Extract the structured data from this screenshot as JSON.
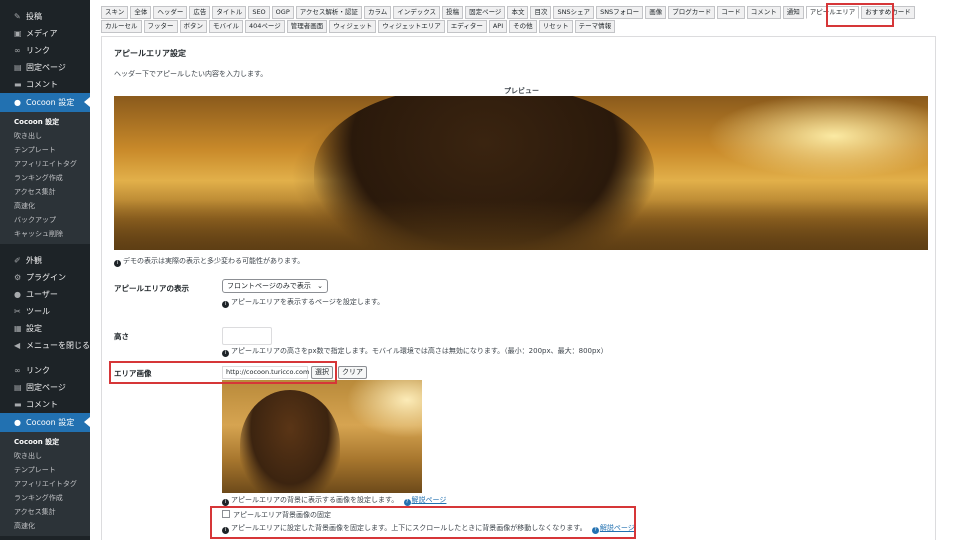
{
  "sidebar": {
    "top_items": [
      {
        "icon": "pin-icon",
        "glyph": "✎",
        "label": "投稿"
      },
      {
        "icon": "media-icon",
        "glyph": "▣",
        "label": "メディア"
      },
      {
        "icon": "link-icon",
        "glyph": "∞",
        "label": "リンク"
      },
      {
        "icon": "page-icon",
        "glyph": "▤",
        "label": "固定ページ"
      },
      {
        "icon": "comment-icon",
        "glyph": "▬",
        "label": "コメント"
      }
    ],
    "cocoon_label": "Cocoon 設定",
    "sub_items": [
      "Cocoon 設定",
      "吹き出し",
      "テンプレート",
      "アフィリエイトタグ",
      "ランキング作成",
      "アクセス集計",
      "高速化",
      "バックアップ",
      "キャッシュ削除"
    ],
    "bottom_items": [
      {
        "icon": "appearance-icon",
        "glyph": "✐",
        "label": "外観"
      },
      {
        "icon": "plugin-icon",
        "glyph": "⚙",
        "label": "プラグイン"
      },
      {
        "icon": "user-icon",
        "glyph": "●",
        "label": "ユーザー"
      },
      {
        "icon": "tool-icon",
        "glyph": "✂",
        "label": "ツール"
      },
      {
        "icon": "settings-icon",
        "glyph": "▦",
        "label": "設定"
      },
      {
        "icon": "collapse-icon",
        "glyph": "◀",
        "label": "メニューを閉じる"
      }
    ],
    "repeat_items": [
      {
        "icon": "link-icon",
        "glyph": "∞",
        "label": "リンク"
      },
      {
        "icon": "page-icon",
        "glyph": "▤",
        "label": "固定ページ"
      },
      {
        "icon": "comment-icon",
        "glyph": "▬",
        "label": "コメント"
      }
    ],
    "cocoon_label_2": "Cocoon 設定",
    "sub_items_2": [
      "Cocoon 設定",
      "吹き出し",
      "テンプレート",
      "アフィリエイトタグ",
      "ランキング作成",
      "アクセス集計",
      "高速化"
    ]
  },
  "tabs": {
    "row1": [
      "スキン",
      "全体",
      "ヘッダー",
      "広告",
      "タイトル",
      "SEO",
      "OGP",
      "アクセス解析・認証",
      "カラム",
      "インデックス",
      "投稿",
      "固定ページ",
      "本文",
      "目次",
      "SNSシェア",
      "SNSフォロー",
      "画像",
      "ブログカード",
      "コード",
      "コメント",
      "通知",
      "アピールエリア",
      "おすすめカード"
    ],
    "row2": [
      "カルーセル",
      "フッター",
      "ボタン",
      "モバイル",
      "404ページ",
      "管理者画面",
      "ウィジェット",
      "ウィジェットエリア",
      "エディター",
      "API",
      "その他",
      "リセット",
      "テーマ情報"
    ],
    "active": "アピールエリア"
  },
  "section": {
    "title": "アピールエリア設定",
    "description": "ヘッダー下でアピールしたい内容を入力します。",
    "preview_label": "プレビュー",
    "demo_note": "デモの表示は実際の表示と多少変わる可能性があります。"
  },
  "display": {
    "label": "アピールエリアの表示",
    "selected": "フロントページのみで表示",
    "help": "アピールエリアを表示するページを設定します。"
  },
  "height": {
    "label": "高さ",
    "value": "",
    "help": "アピールエリアの高さをpx数で指定します。モバイル環境では高さは無効になります。（最小：200px、最大：800px）"
  },
  "area_image": {
    "label": "エリア画像",
    "url": "http://cocoon.turicco.com",
    "select_button": "選択",
    "clear_button": "クリア",
    "help": "アピールエリアの背景に表示する画像を設定します。",
    "help_link": "解説ページ"
  },
  "fixed_bg": {
    "checkbox_label": "アピールエリア背景画像の固定",
    "help": "アピールエリアに設定した背景画像を固定します。上下にスクロールしたときに背景画像が移動しなくなります。",
    "help_link": "解説ページ",
    "checked": false
  },
  "colors": {
    "sidebar_bg": "#1d2327",
    "accent": "#2271b1",
    "highlight": "#d63638"
  }
}
